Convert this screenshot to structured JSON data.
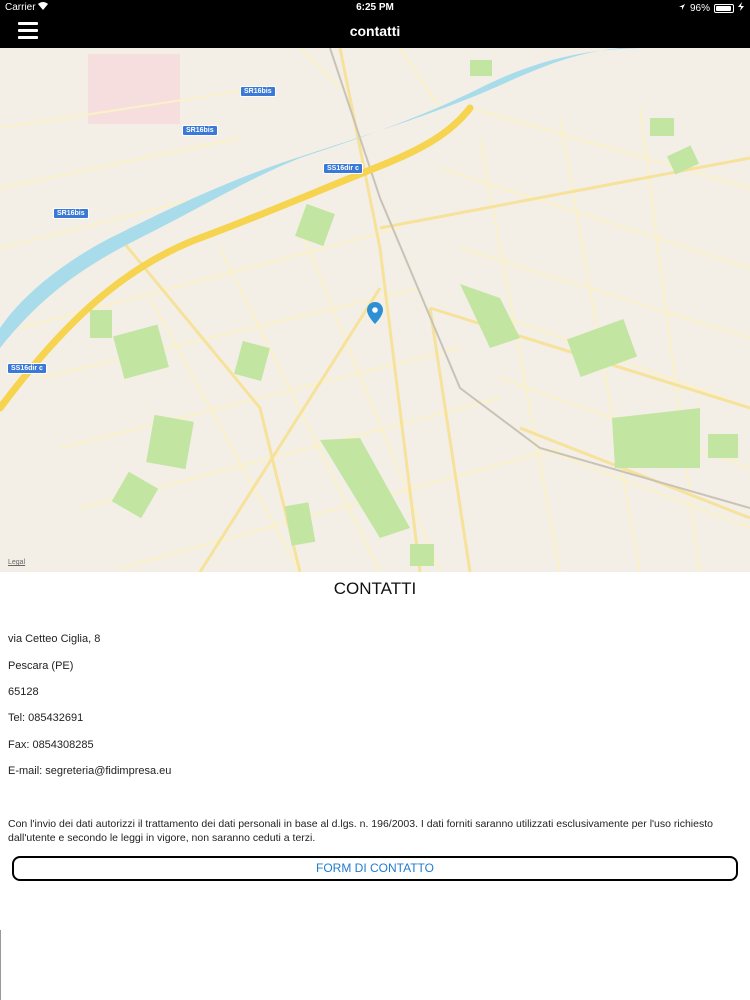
{
  "status_bar": {
    "carrier": "Carrier",
    "time": "6:25 PM",
    "battery": "96%",
    "battery_level": 0.96
  },
  "nav": {
    "title": "contatti",
    "menu_icon": "hamburger-menu-icon"
  },
  "map": {
    "road_labels": [
      "SR16bis",
      "SR16bis",
      "SS16dir c",
      "SR16bis",
      "SS16dir c"
    ],
    "legal_label": "Legal",
    "pin_icon": "map-pin-icon",
    "colors": {
      "river": "#a9dceb",
      "highway": "#f6d44f",
      "park": "#c2e5a2",
      "land": "#f3efe6",
      "roads": "#fbf1c8",
      "pin": "#2d8fd5"
    }
  },
  "content": {
    "title": "CONTATTI",
    "address": "via Cetteo Ciglia, 8",
    "city": "Pescara (PE)",
    "zip": "65128",
    "tel": "Tel: 085432691",
    "fax": "Fax: 0854308285",
    "email": "E-mail:  segreteria@fidimpresa.eu",
    "disclaimer": "Con l'invio dei dati autorizzi il trattamento dei dati personali in base al d.lgs. n. 196/2003. I dati forniti saranno utilizzati esclusivamente per l'uso richiesto dall'utente e secondo le leggi in vigore, non saranno ceduti a terzi.",
    "form_button": "FORM DI CONTATTO",
    "button_text_color": "#1f7cd1"
  }
}
